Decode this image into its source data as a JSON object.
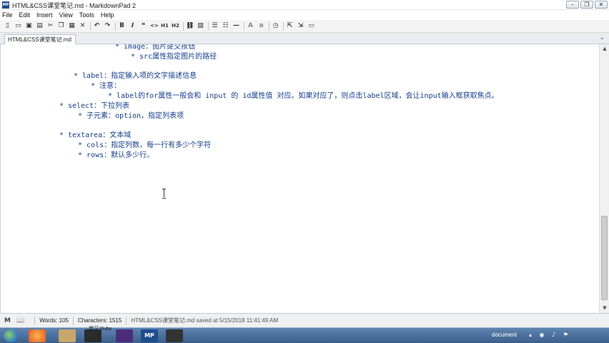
{
  "window": {
    "title": "HTML&CSS课堂笔记.md - MarkdownPad 2",
    "app_icon": "MP",
    "buttons": [
      "minimize-icon",
      "restore-icon",
      "close-icon"
    ]
  },
  "menu": [
    "File",
    "Edit",
    "Insert",
    "View",
    "Tools",
    "Help"
  ],
  "toolbar": {
    "h1_label": "H1",
    "h2_label": "H2",
    "quote_label": "❝",
    "code_label": "<>",
    "icons": [
      "new-icon",
      "open-icon",
      "save-icon",
      "save-all-icon",
      "cut-icon",
      "copy-icon",
      "paste-icon",
      "delete-icon",
      "undo-icon",
      "redo-icon",
      "bold-icon",
      "italic-icon",
      "quote-icon",
      "code-icon",
      "h1-icon",
      "h2-icon",
      "link-icon",
      "image-icon",
      "unordered-list-icon",
      "ordered-list-icon",
      "horizontal-rule-icon",
      "uppercase-icon",
      "lowercase-icon",
      "timestamp-icon",
      "live-preview-icon",
      "export-icon",
      "preview-icon"
    ]
  },
  "tab": {
    "label": "HTML&CSS课堂笔记.md"
  },
  "editor": {
    "lines": [
      "* image：图片提交按钮",
      "* src属性指定图片的路径",
      "* label：指定输入项的文字描述信息",
      "* 注意：",
      "* label的for属性一般会和 input 的 id属性值 对应。如果对应了，则点击label区域，会让input输入框获取焦点。",
      "* select：下拉列表",
      "* 子元素：option，指定列表项",
      "* textarea：文本域",
      "* cols：指定列数，每一行有多少个字符",
      "* rows：默认多少行。"
    ]
  },
  "status": {
    "words": "Words: 105",
    "characters": "Characters: 1515",
    "saved": "HTML&CSS课堂笔记.md saved at 5/15/2018 11:41:49 AM"
  },
  "taskbar": {
    "tooltip": "学习 Ruby",
    "tray_text": "document",
    "app_label": "MP"
  }
}
